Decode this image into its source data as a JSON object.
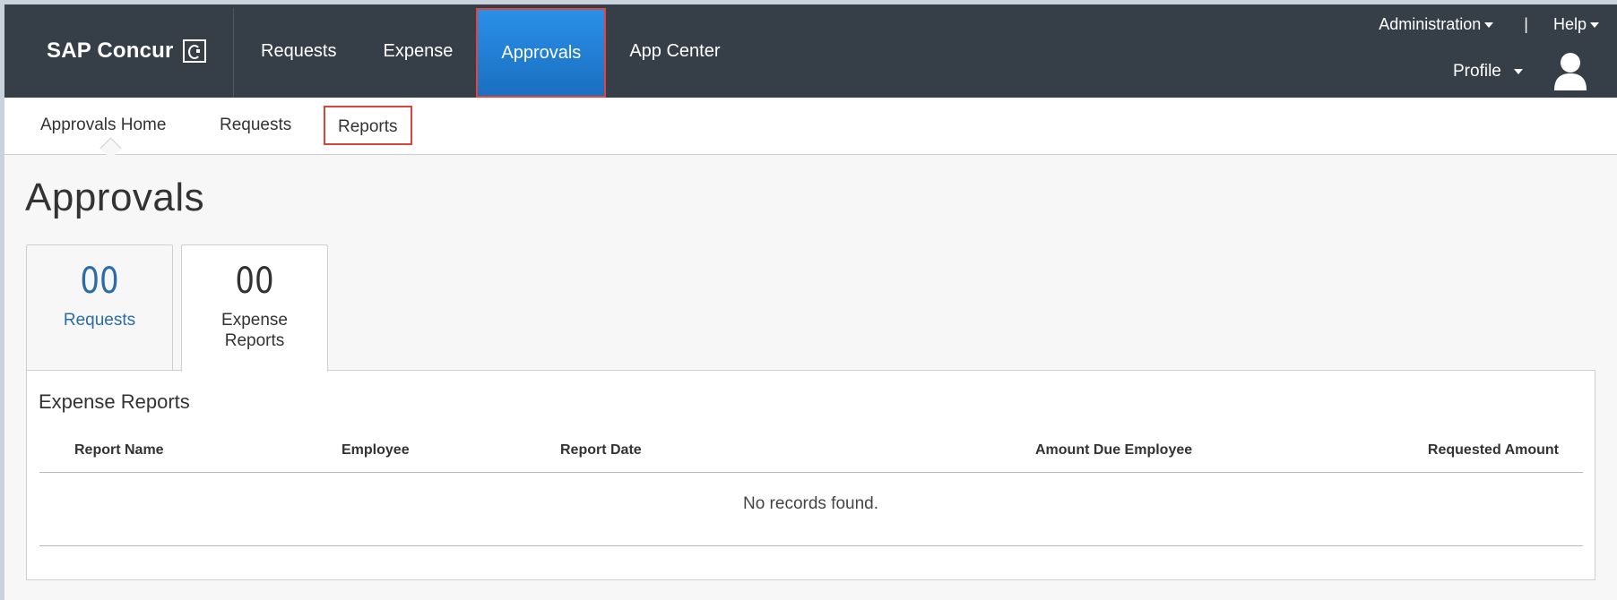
{
  "header": {
    "brand": "SAP Concur",
    "nav": [
      {
        "label": "Requests",
        "active": false
      },
      {
        "label": "Expense",
        "active": false
      },
      {
        "label": "Approvals",
        "active": true
      },
      {
        "label": "App Center",
        "active": false
      }
    ],
    "administration_label": "Administration",
    "separator": "|",
    "help_label": "Help",
    "profile_label": "Profile",
    "accent_color": "#1f7ad1",
    "highlight_color": "#d9453d"
  },
  "subnav": {
    "items": [
      {
        "label": "Approvals Home",
        "current": true
      },
      {
        "label": "Requests",
        "current": false
      },
      {
        "label": "Reports",
        "current": false
      }
    ]
  },
  "page": {
    "title": "Approvals"
  },
  "cards": [
    {
      "count": "00",
      "label": "Requests",
      "selected": false
    },
    {
      "count": "00",
      "label_line1": "Expense",
      "label_line2": "Reports",
      "selected": true
    }
  ],
  "expense_reports": {
    "title": "Expense Reports",
    "columns": [
      "Report Name",
      "Employee",
      "Report Date",
      "Amount Due Employee",
      "Requested Amount"
    ],
    "rows": [],
    "empty_message": "No records found."
  }
}
